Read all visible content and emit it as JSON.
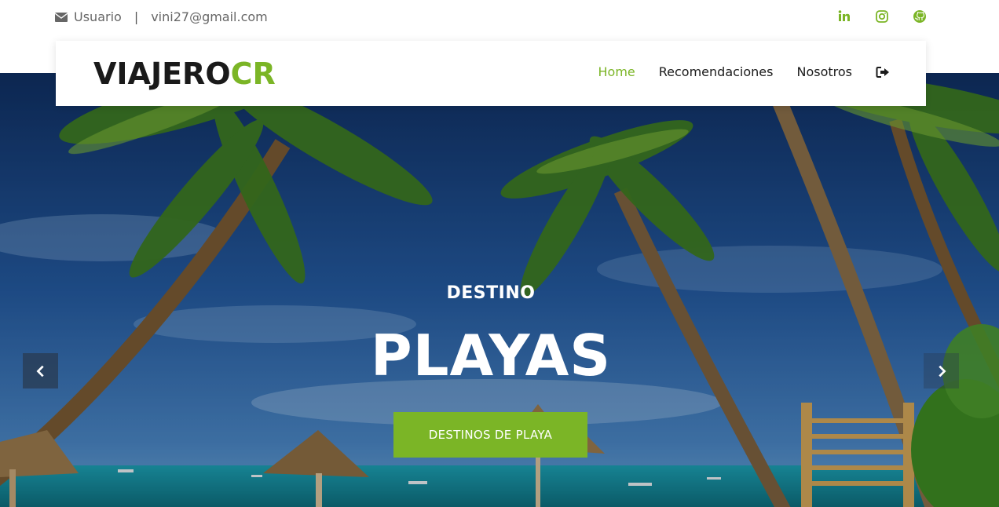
{
  "topbar": {
    "user_label": "Usuario",
    "separator": "|",
    "email": "vini27@gmail.com",
    "icons": [
      "envelope-icon",
      "linkedin-icon",
      "instagram-icon",
      "github-icon"
    ]
  },
  "brand": {
    "part1": "VIAJERO",
    "part2": "CR"
  },
  "nav": {
    "items": [
      {
        "label": "Home",
        "active": true
      },
      {
        "label": "Recomendaciones",
        "active": false
      },
      {
        "label": "Nosotros",
        "active": false
      }
    ],
    "logout_icon": "sign-out-icon"
  },
  "hero": {
    "eyebrow": "DESTINO",
    "headline": "PLAYAS",
    "cta_label": "DESTINOS DE PLAYA",
    "prev_icon": "chevron-left-icon",
    "next_icon": "chevron-right-icon"
  },
  "colors": {
    "accent": "#7bb526",
    "dark": "#1a1a1a",
    "sky": "#1f4f8f",
    "sea": "#1fa7b0"
  }
}
